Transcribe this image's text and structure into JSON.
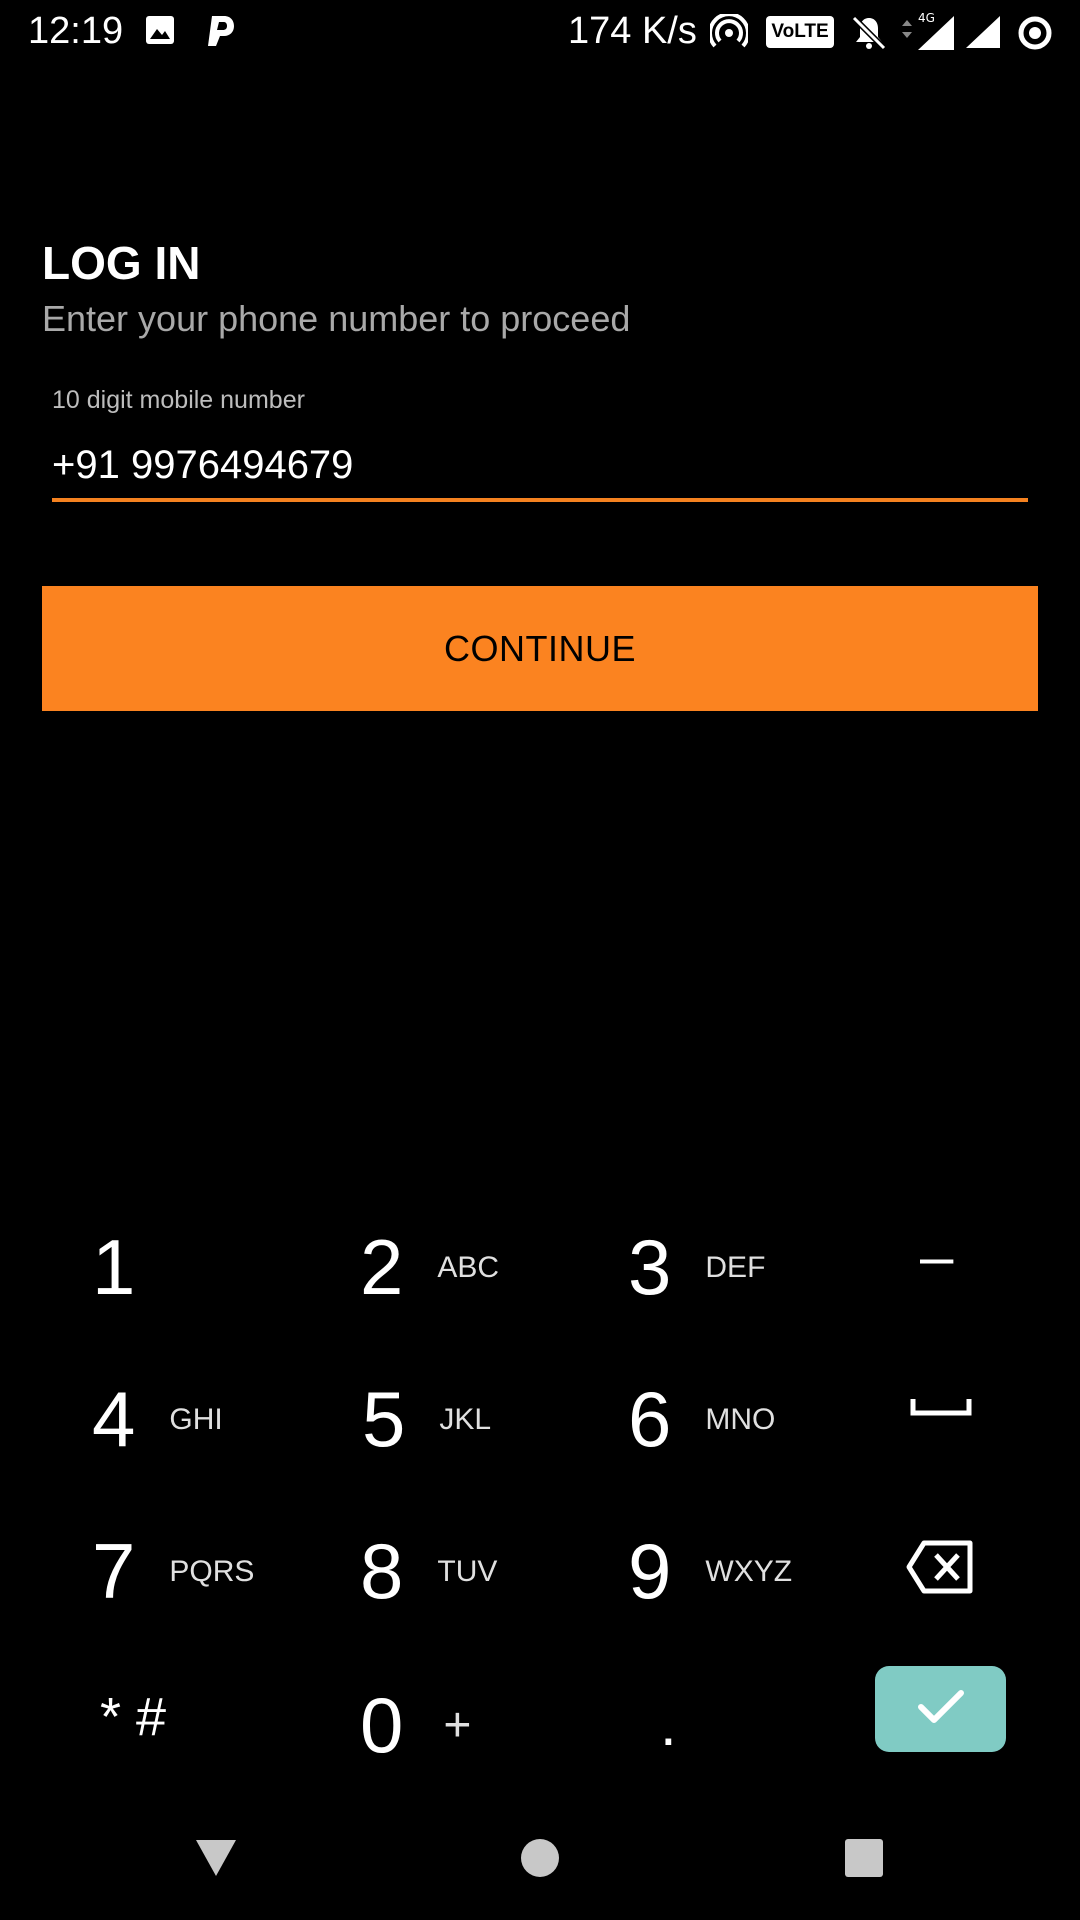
{
  "status_bar": {
    "time": "12:19",
    "speed": "174 K/s",
    "volte": "VoLTE",
    "network": "4G"
  },
  "screen": {
    "title": "LOG IN",
    "subtitle": "Enter your phone number to proceed"
  },
  "phone_field": {
    "label": "10 digit mobile number",
    "value": "+91 9976494679"
  },
  "continue_button": {
    "label": "CONTINUE"
  },
  "keypad": {
    "keys": [
      {
        "digit": "1",
        "letters": ""
      },
      {
        "digit": "2",
        "letters": "ABC"
      },
      {
        "digit": "3",
        "letters": "DEF"
      },
      {
        "digit": "4",
        "letters": "GHI"
      },
      {
        "digit": "5",
        "letters": "JKL"
      },
      {
        "digit": "6",
        "letters": "MNO"
      },
      {
        "digit": "7",
        "letters": "PQRS"
      },
      {
        "digit": "8",
        "letters": "TUV"
      },
      {
        "digit": "9",
        "letters": "WXYZ"
      },
      {
        "digit": "0",
        "letters": "+"
      }
    ],
    "minus": "–",
    "star_hash": "* #",
    "period": "."
  },
  "colors": {
    "accent": "#fb8320",
    "done_key": "#80cbc4",
    "background": "#000000"
  }
}
